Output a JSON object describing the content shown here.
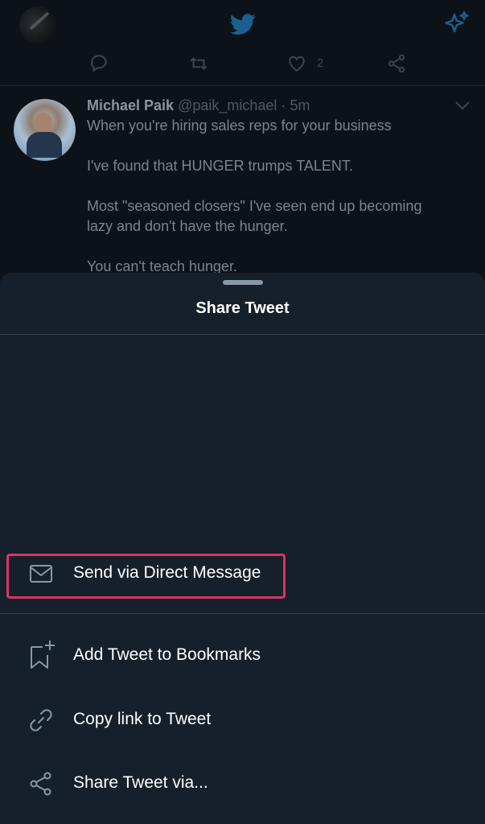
{
  "header": {
    "avatar_icon": "profile-avatar",
    "logo_icon": "twitter-bird-icon",
    "sparkle_icon": "sparkle-icon",
    "brand_color": "#1da1f2"
  },
  "tweet_actions": {
    "reply_icon": "reply-icon",
    "retweet_icon": "retweet-icon",
    "like_icon": "heart-icon",
    "like_count": "2",
    "share_icon": "share-icon"
  },
  "tweet": {
    "name": "Michael Paik",
    "handle": "@paik_michael",
    "separator": "·",
    "time": "5m",
    "lines": [
      "When you're hiring sales reps for your business",
      "I've found that HUNGER trumps TALENT.",
      "Most \"seasoned closers\" I've seen end up becoming",
      "lazy and don't have the hunger.",
      "You can't teach hunger."
    ]
  },
  "share_sheet": {
    "title": "Share Tweet",
    "items": [
      {
        "label": "Send via Direct Message",
        "icon": "mail-icon"
      },
      {
        "label": "Add Tweet to Bookmarks",
        "icon": "bookmark-add-icon"
      },
      {
        "label": "Copy link to Tweet",
        "icon": "link-icon"
      },
      {
        "label": "Share Tweet via...",
        "icon": "share-icon"
      }
    ],
    "highlight_color": "#d8336a"
  }
}
